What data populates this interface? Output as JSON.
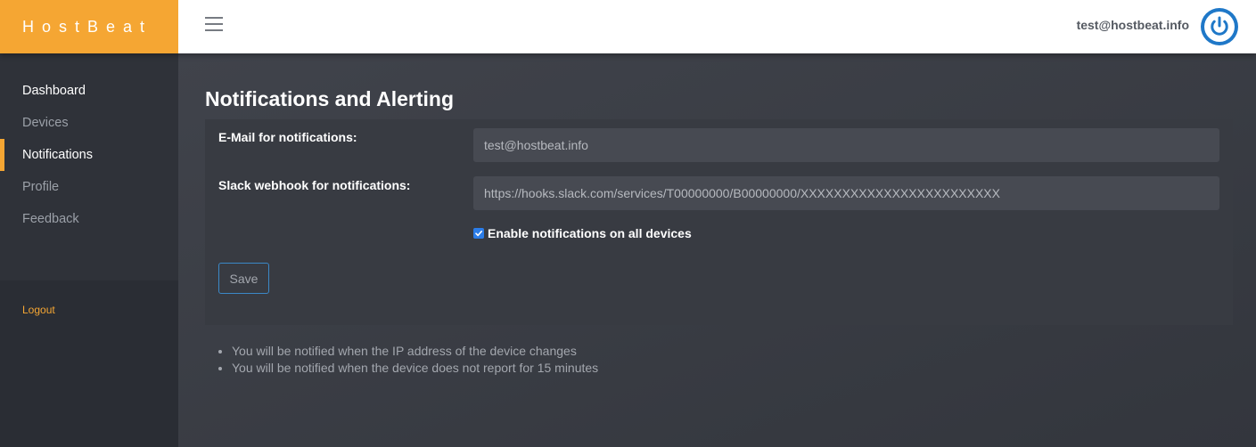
{
  "brand": {
    "name": "HostBeat",
    "color": "#f5a633"
  },
  "header": {
    "menu_icon": "hamburger-menu-icon",
    "user_email": "test@hostbeat.info",
    "power_icon": "power-icon",
    "power_color": "#1f78c8"
  },
  "sidebar": {
    "items": [
      {
        "label": "Dashboard",
        "active": false
      },
      {
        "label": "Devices",
        "active": false
      },
      {
        "label": "Notifications",
        "active": true
      },
      {
        "label": "Profile",
        "active": false
      },
      {
        "label": "Feedback",
        "active": false
      }
    ],
    "logout_label": "Logout"
  },
  "page": {
    "title": "Notifications and Alerting"
  },
  "form": {
    "email_label": "E-Mail for notifications:",
    "email_value": "test@hostbeat.info",
    "slack_label": "Slack webhook for notifications:",
    "slack_value": "https://hooks.slack.com/services/T00000000/B00000000/XXXXXXXXXXXXXXXXXXXXXXXX",
    "enable_all_label": "Enable notifications on all devices",
    "enable_all_checked": true,
    "save_label": "Save"
  },
  "notes": [
    "You will be notified when the IP address of the device changes",
    "You will be notified when the device does not report for 15 minutes"
  ]
}
